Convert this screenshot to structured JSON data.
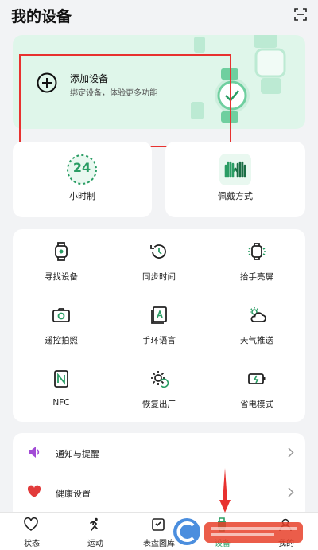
{
  "header": {
    "title": "我的设备"
  },
  "add_device": {
    "title": "添加设备",
    "subtitle": "绑定设备，体验更多功能"
  },
  "features": {
    "clock_24_number": "24",
    "clock_24_label": "小时制",
    "wear_label": "佩戴方式"
  },
  "tools": [
    {
      "label": "寻找设备",
      "icon": "watch-search-icon"
    },
    {
      "label": "同步时间",
      "icon": "history-clock-icon"
    },
    {
      "label": "抬手亮屏",
      "icon": "watch-glow-icon"
    },
    {
      "label": "遥控拍照",
      "icon": "camera-icon"
    },
    {
      "label": "手环语言",
      "icon": "language-icon"
    },
    {
      "label": "天气推送",
      "icon": "weather-icon"
    },
    {
      "label": "NFC",
      "icon": "nfc-icon"
    },
    {
      "label": "恢复出厂",
      "icon": "factory-reset-icon"
    },
    {
      "label": "省电模式",
      "icon": "battery-saver-icon"
    }
  ],
  "settings_list": [
    {
      "label": "通知与提醒",
      "icon": "speaker-icon",
      "color": "#a24bd6"
    },
    {
      "label": "健康设置",
      "icon": "heart-icon",
      "color": "#e23b3b"
    }
  ],
  "bottom_nav": [
    {
      "label": "状态",
      "icon": "heart-outline-icon",
      "active": false
    },
    {
      "label": "运动",
      "icon": "running-icon",
      "active": false
    },
    {
      "label": "表盘图库",
      "icon": "watchface-icon",
      "active": false
    },
    {
      "label": "设备",
      "icon": "device-icon",
      "active": true
    },
    {
      "label": "我的",
      "icon": "profile-icon",
      "active": false
    }
  ],
  "colors": {
    "accent": "#2a9d64",
    "card_green": "#dff6ea",
    "highlight_red": "#e8312f"
  }
}
